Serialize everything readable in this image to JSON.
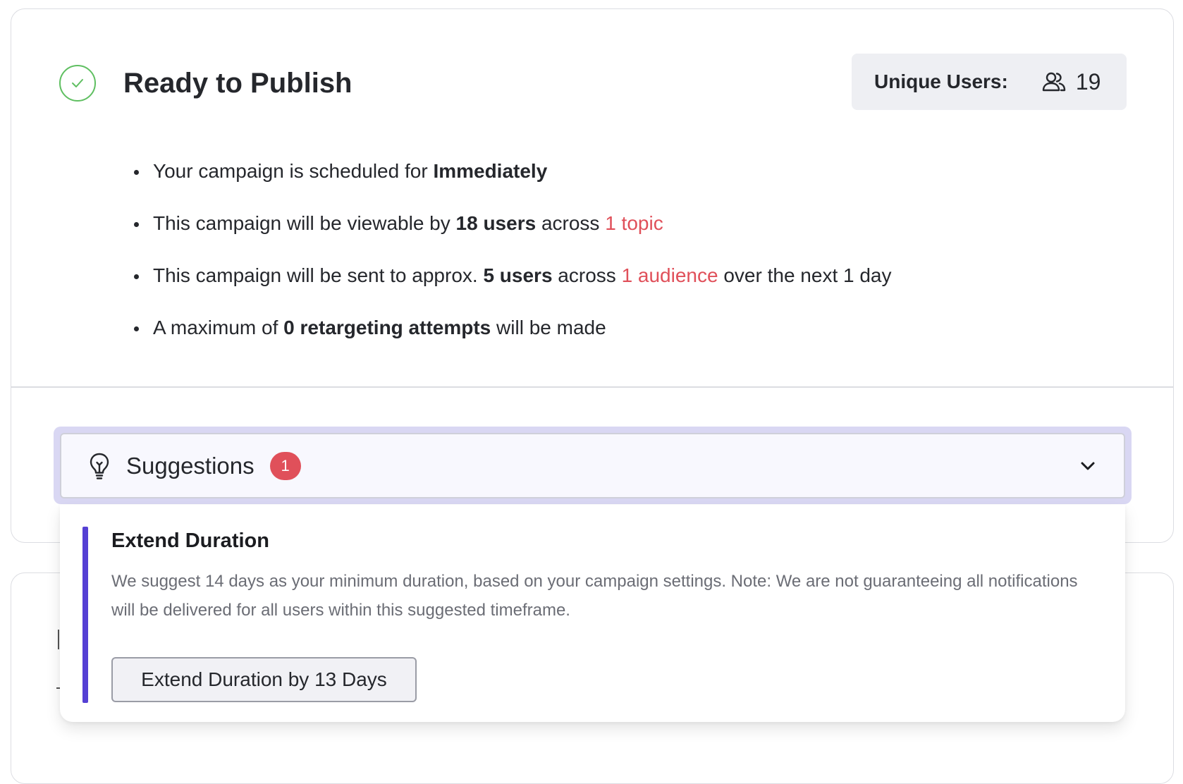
{
  "header": {
    "title": "Ready to Publish",
    "unique_users_label": "Unique Users:",
    "unique_users_value": "19"
  },
  "summary": {
    "schedule": {
      "text_before": "Your campaign is scheduled for ",
      "bold": "Immediately"
    },
    "viewable": {
      "text_before": "This campaign will be viewable by ",
      "bold": "18 users",
      "text_mid": " across ",
      "link": "1 topic"
    },
    "sent": {
      "text_before": "This campaign will be sent to approx. ",
      "bold": "5 users",
      "text_mid": " across ",
      "link": "1 audience",
      "text_after": " over the next 1 day"
    },
    "retargeting": {
      "text_before": "A maximum of ",
      "bold": "0 retargeting attempts",
      "text_after": " will be made"
    }
  },
  "suggestions": {
    "label": "Suggestions",
    "count": "1",
    "items": [
      {
        "title": "Extend Duration",
        "description": "We suggest 14 days as your minimum duration, based on your campaign settings. Note: We are not guaranteeing all notifications will be delivered for all users within this suggested timeframe.",
        "action_label": "Extend Duration by 13 Days"
      }
    ]
  },
  "colors": {
    "accent_purple": "#5540d4",
    "link_red": "#e0505a",
    "success_green": "#5fbf61",
    "badge_red": "#e0505a"
  },
  "icons": {
    "status": "check-circle-icon",
    "users": "users-icon",
    "suggestions": "lightbulb-icon",
    "expand": "chevron-down-icon"
  }
}
